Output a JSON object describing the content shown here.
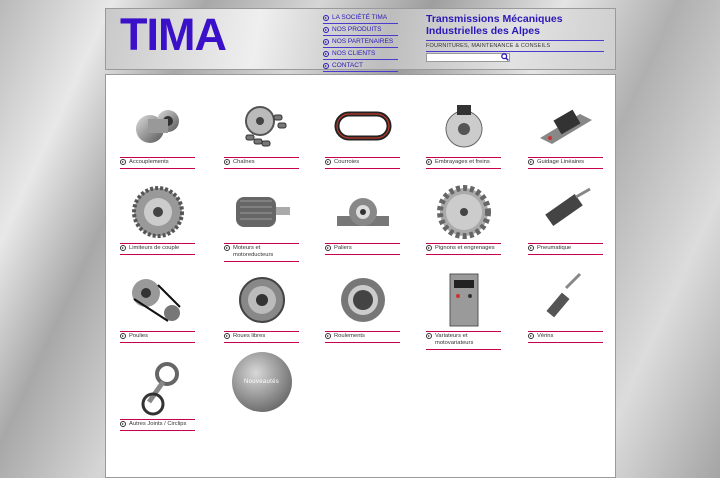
{
  "header": {
    "logo": "TIMA",
    "nav": [
      "LA SOCIÉTÉ TIMA",
      "NOS PRODUITS",
      "NOS PARTENAIRES",
      "NOS CLIENTS",
      "CONTACT"
    ],
    "company_line1": "Transmissions Mécaniques",
    "company_line2": "Industrielles des Alpes",
    "tagline": "FOURNITURES, MAINTENANCE & CONSEILS"
  },
  "products": [
    {
      "label": "Accouplements",
      "icon": "coupling-icon"
    },
    {
      "label": "Chaînes",
      "icon": "chain-icon"
    },
    {
      "label": "Courroies",
      "icon": "belt-icon"
    },
    {
      "label": "Embrayages et freins",
      "icon": "clutch-icon"
    },
    {
      "label": "Guidage Linéaires",
      "icon": "linear-guide-icon"
    },
    {
      "label": "Limiteurs de couple",
      "icon": "torque-limiter-icon"
    },
    {
      "label": "Moteurs et motoreducteurs",
      "icon": "motor-icon"
    },
    {
      "label": "Paliers",
      "icon": "bearing-block-icon"
    },
    {
      "label": "Pignons et engrenages",
      "icon": "gear-icon"
    },
    {
      "label": "Pneumatique",
      "icon": "pneumatic-cylinder-icon"
    },
    {
      "label": "Poulies",
      "icon": "pulley-icon"
    },
    {
      "label": "Roues libres",
      "icon": "freewheel-icon"
    },
    {
      "label": "Roulements",
      "icon": "ball-bearing-icon"
    },
    {
      "label": "Variateurs et motovariateurs",
      "icon": "variator-icon"
    },
    {
      "label": "Vérins",
      "icon": "actuator-icon"
    },
    {
      "label": "Autres Joints / Circlips",
      "icon": "joints-icon"
    }
  ],
  "nouveautes": "Nouveautés"
}
